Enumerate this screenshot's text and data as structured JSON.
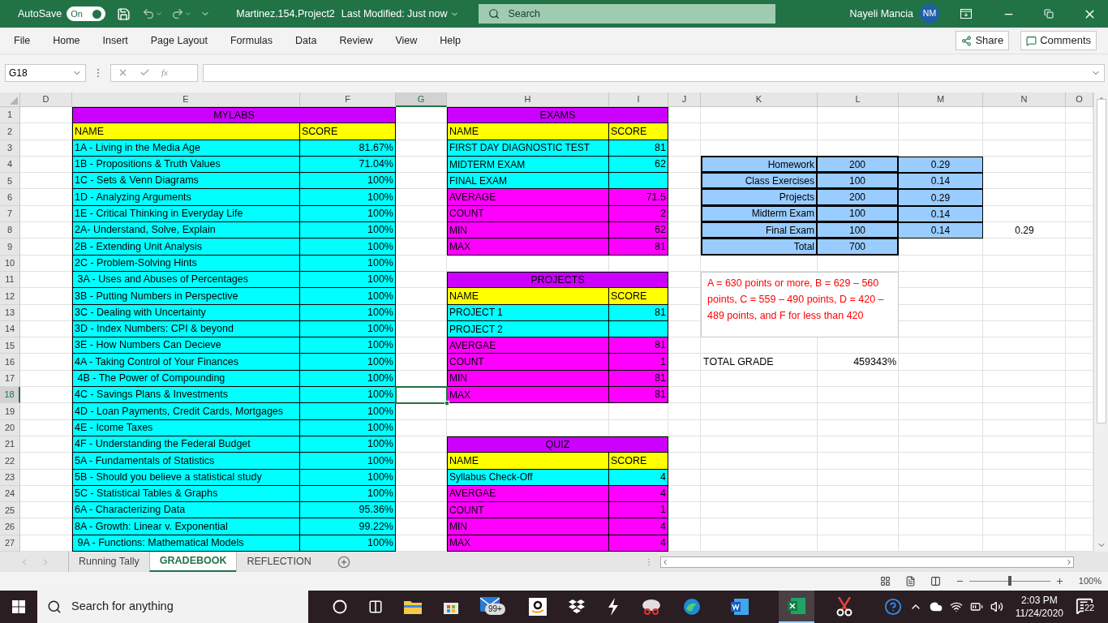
{
  "title_bar": {
    "autosave_label": "AutoSave",
    "autosave": {
      "label": "On",
      "on": true
    },
    "file_title": "Martinez.154.Project2",
    "modified": "Last Modified: Just now",
    "search_placeholder": "Search",
    "user_name": "Nayeli Mancia",
    "user_initials": "NM"
  },
  "menu": [
    "File",
    "Home",
    "Insert",
    "Page Layout",
    "Formulas",
    "Data",
    "Review",
    "View",
    "Help"
  ],
  "share_label": "Share",
  "comments_label": "Comments",
  "formula_bar": {
    "name_box": "G18",
    "fx_label": "fx"
  },
  "columns": [
    {
      "label": "D",
      "selected": false
    },
    {
      "label": "E",
      "selected": false
    },
    {
      "label": "F",
      "selected": false
    },
    {
      "label": "G",
      "selected": true
    },
    {
      "label": "H",
      "selected": false
    },
    {
      "label": "I",
      "selected": false
    },
    {
      "label": "J",
      "selected": false
    },
    {
      "label": "K",
      "selected": false
    },
    {
      "label": "L",
      "selected": false
    },
    {
      "label": "M",
      "selected": false
    },
    {
      "label": "N",
      "selected": false
    },
    {
      "label": "O",
      "selected": false
    }
  ],
  "rows": [
    {
      "label": "1",
      "selected": false
    },
    {
      "label": "2",
      "selected": false
    },
    {
      "label": "3",
      "selected": false
    },
    {
      "label": "4",
      "selected": false
    },
    {
      "label": "5",
      "selected": false
    },
    {
      "label": "6",
      "selected": false
    },
    {
      "label": "7",
      "selected": false
    },
    {
      "label": "8",
      "selected": false
    },
    {
      "label": "9",
      "selected": false
    },
    {
      "label": "10",
      "selected": false
    },
    {
      "label": "11",
      "selected": false
    },
    {
      "label": "12",
      "selected": false
    },
    {
      "label": "13",
      "selected": false
    },
    {
      "label": "14",
      "selected": false
    },
    {
      "label": "15",
      "selected": false
    },
    {
      "label": "16",
      "selected": false
    },
    {
      "label": "17",
      "selected": false
    },
    {
      "label": "18",
      "selected": true
    },
    {
      "label": "19",
      "selected": false
    },
    {
      "label": "20",
      "selected": false
    },
    {
      "label": "21",
      "selected": false
    },
    {
      "label": "22",
      "selected": false
    },
    {
      "label": "23",
      "selected": false
    },
    {
      "label": "24",
      "selected": false
    },
    {
      "label": "25",
      "selected": false
    },
    {
      "label": "26",
      "selected": false
    },
    {
      "label": "27",
      "selected": false
    }
  ],
  "mylabs": {
    "title": "MYLABS",
    "headers": [
      "NAME",
      "SCORE"
    ],
    "rows": [
      {
        "kind": "item",
        "name": "1A - Living in the Media Age",
        "score": "81.67%"
      },
      {
        "kind": "item",
        "name": "1B - Propositions & Truth Values",
        "score": "71.04%"
      },
      {
        "kind": "item",
        "name": "1C - Sets & Venn Diagrams",
        "score": "100%"
      },
      {
        "kind": "item",
        "name": "1D - Analyzing Arguments",
        "score": "100%"
      },
      {
        "kind": "item",
        "name": "1E - Critical Thinking in Everyday Life",
        "score": "100%"
      },
      {
        "kind": "item",
        "name": "2A- Understand, Solve, Explain",
        "score": "100%"
      },
      {
        "kind": "item",
        "name": "2B - Extending Unit Analysis",
        "score": "100%"
      },
      {
        "kind": "item",
        "name": "2C - Problem-Solving Hints",
        "score": "100%"
      },
      {
        "kind": "item",
        "name": " 3A - Uses and Abuses of Percentages",
        "score": "100%"
      },
      {
        "kind": "item",
        "name": "3B - Putting Numbers in Perspective",
        "score": "100%"
      },
      {
        "kind": "item",
        "name": "3C - Dealing with Uncertainty",
        "score": "100%"
      },
      {
        "kind": "item",
        "name": "3D - Index Numbers: CPI & beyond",
        "score": "100%"
      },
      {
        "kind": "item",
        "name": "3E - How Numbers Can Decieve",
        "score": "100%"
      },
      {
        "kind": "item",
        "name": "4A - Taking Control of Your Finances",
        "score": "100%"
      },
      {
        "kind": "item",
        "name": " 4B - The Power of Compounding",
        "score": "100%"
      },
      {
        "kind": "item",
        "name": "4C - Savings Plans & Investments",
        "score": "100%"
      },
      {
        "kind": "item",
        "name": "4D - Loan Payments, Credit Cards, Mortgages",
        "score": "100%"
      },
      {
        "kind": "item",
        "name": "4E - Icome Taxes",
        "score": "100%"
      },
      {
        "kind": "item",
        "name": "4F - Understanding the Federal Budget",
        "score": "100%"
      },
      {
        "kind": "item",
        "name": "5A - Fundamentals of Statistics",
        "score": "100%"
      },
      {
        "kind": "item",
        "name": "5B - Should you believe a statistical study",
        "score": "100%"
      },
      {
        "kind": "item",
        "name": "5C - Statistical Tables & Graphs",
        "score": "100%"
      },
      {
        "kind": "item",
        "name": "6A - Characterizing Data",
        "score": "95.36%"
      },
      {
        "kind": "item",
        "name": "8A - Growth: Linear v. Exponential",
        "score": "99.22%"
      },
      {
        "kind": "item",
        "name": " 9A - Functions: Mathematical Models",
        "score": "100%"
      }
    ]
  },
  "exams": {
    "title": "EXAMS",
    "headers": [
      "NAME",
      "SCORE"
    ],
    "rows": [
      {
        "kind": "item",
        "name": "FIRST DAY DIAGNOSTIC TEST",
        "score": "81"
      },
      {
        "kind": "item",
        "name": "MIDTERM EXAM",
        "score": "62"
      },
      {
        "kind": "item",
        "name": "FINAL EXAM"
      },
      {
        "kind": "stat",
        "name": "AVERAGE",
        "score": "71.5"
      },
      {
        "kind": "stat",
        "name": "COUNT",
        "score": "2"
      },
      {
        "kind": "stat",
        "name": "MIN",
        "score": "62"
      },
      {
        "kind": "stat",
        "name": "MAX",
        "score": "81"
      }
    ]
  },
  "projects": {
    "title": "PROJECTS",
    "headers": [
      "NAME",
      "SCORE"
    ],
    "rows": [
      {
        "kind": "item",
        "name": "PROJECT 1",
        "score": "81"
      },
      {
        "kind": "item",
        "name": "PROJECT 2"
      },
      {
        "kind": "stat",
        "name": "AVERGAE",
        "score": "81"
      },
      {
        "kind": "stat",
        "name": "COUNT",
        "score": "1"
      },
      {
        "kind": "stat",
        "name": "MIN",
        "score": "81"
      },
      {
        "kind": "stat",
        "name": "MAX",
        "score": "81"
      }
    ]
  },
  "quiz": {
    "title": "QUIZ",
    "headers": [
      "NAME",
      "SCORE"
    ],
    "rows": [
      {
        "kind": "item",
        "name": "Syllabus Check-Off",
        "score": "4"
      },
      {
        "kind": "stat",
        "name": "AVERGAE",
        "score": "4"
      },
      {
        "kind": "stat",
        "name": "COUNT",
        "score": "1"
      },
      {
        "kind": "stat",
        "name": "MIN",
        "score": "4"
      },
      {
        "kind": "stat",
        "name": "MAX",
        "score": "4"
      }
    ]
  },
  "weights": [
    {
      "label": "Homework",
      "points": "200",
      "share": "0.29"
    },
    {
      "label": "Class Exercises",
      "points": "100",
      "share": "0.14"
    },
    {
      "label": "Projects",
      "points": "200",
      "share": "0.29"
    },
    {
      "label": "Midterm Exam",
      "points": "100",
      "share": "0.14"
    },
    {
      "label": "Final Exam",
      "points": "100",
      "share": "0.14"
    },
    {
      "label": "Total",
      "points": "700"
    }
  ],
  "n8_value": "0.29",
  "grade_scale_note": "A = 630 points or more, B = 629 – 560 points, C = 559 – 490 points, D = 420 – 489 points, and F for less than 420",
  "total_grade": {
    "label": "TOTAL GRADE",
    "value": "459343%"
  },
  "sheet_tabs": [
    {
      "label": "Running Tally",
      "selected": false
    },
    {
      "label": "GRADEBOOK",
      "selected": true
    },
    {
      "label": "REFLECTION",
      "selected": false
    }
  ],
  "zoom": {
    "reading": "100%",
    "level": 0.5
  },
  "taskbar": {
    "search_placeholder": "Search for anything",
    "mail_badge": "99+",
    "time": "2:03 PM",
    "date": "11/24/2020",
    "notifications": "22"
  }
}
